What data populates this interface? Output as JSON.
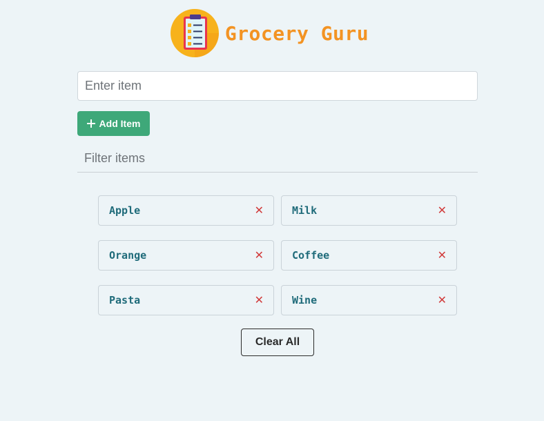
{
  "header": {
    "title": "Grocery Guru",
    "logo_icon": "clipboard-checklist-icon"
  },
  "item_input": {
    "value": "",
    "placeholder": "Enter item"
  },
  "add_button": {
    "label": "Add Item",
    "icon": "plus-icon",
    "color": "#3ea879"
  },
  "filter_input": {
    "value": "",
    "placeholder": "Filter items"
  },
  "items": [
    {
      "name": "Apple",
      "remove_icon": "close-icon",
      "remove_glyph": "✕"
    },
    {
      "name": "Milk",
      "remove_icon": "close-icon",
      "remove_glyph": "✕"
    },
    {
      "name": "Orange",
      "remove_icon": "close-icon",
      "remove_glyph": "✕"
    },
    {
      "name": "Coffee",
      "remove_icon": "close-icon",
      "remove_glyph": "✕"
    },
    {
      "name": "Pasta",
      "remove_icon": "close-icon",
      "remove_glyph": "✕"
    },
    {
      "name": "Wine",
      "remove_icon": "close-icon",
      "remove_glyph": "✕"
    }
  ],
  "clear_button": {
    "label": "Clear All"
  },
  "colors": {
    "background": "#edf4f7",
    "title": "#f39323",
    "item_text": "#1f6b7a",
    "remove": "#d13b3b"
  }
}
